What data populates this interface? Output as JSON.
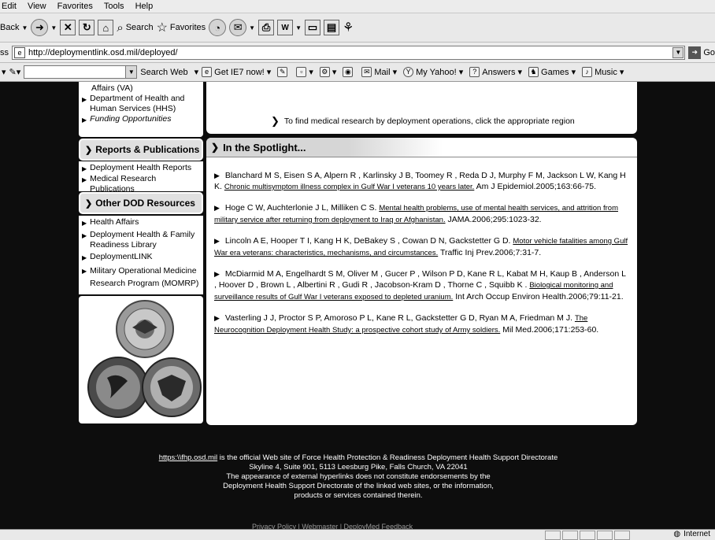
{
  "menubar": {
    "items": [
      "Edit",
      "View",
      "Favorites",
      "Tools",
      "Help"
    ]
  },
  "toolbar": {
    "back_label": "Back",
    "search_label": "Search",
    "favorites_label": "Favorites"
  },
  "address": {
    "label": "ss",
    "url": "http://deploymentlink.osd.mil/deployed/",
    "go_label": "Go"
  },
  "yahoo": {
    "search_web_label": "Search Web",
    "ie7_label": "Get IE7 now!",
    "mail_label": "Mail",
    "my_yahoo_label": "My Yahoo!",
    "answers_label": "Answers",
    "games_label": "Games",
    "music_label": "Music"
  },
  "sidebar": {
    "top_items": [
      {
        "label": "Affairs (VA)",
        "bullet": false
      },
      {
        "label": "Department of Health and Human Services (HHS)",
        "bullet": true
      },
      {
        "label": "Funding Opportunities",
        "bullet": true
      }
    ],
    "reports_heading": "Reports & Publications",
    "reports_items": [
      "Deployment Health Reports",
      "Medical Research Publications"
    ],
    "dod_heading": "Other DOD Resources",
    "dod_items": [
      "Health Affairs",
      "Deployment Health & Family Readiness Library",
      "DeploymentLINK",
      "Military Operational Medicine Research Program (MOMRP)"
    ]
  },
  "main": {
    "region_message": "To find medical research by deployment operations, click the appropriate region",
    "spotlight_heading": "In the Spotlight...",
    "citations": [
      {
        "authors": "Blanchard M S, Eisen S A, Alpern R , Karlinsky J B, Toomey R , Reda D J, Murphy F M, Jackson L W, Kang H K.",
        "title": "Chronic multisymptom illness complex in Gulf War I veterans 10 years later.",
        "source": "Am J Epidemiol.2005;163:66-75."
      },
      {
        "authors": "Hoge C W, Auchterlonie J L, Milliken C S.",
        "title": "Mental health problems, use of mental health services, and attrition from military service after returning from deployment to Iraq or Afghanistan.",
        "source": "JAMA.2006;295:1023-32."
      },
      {
        "authors": "Lincoln A E, Hooper T I, Kang H K, DeBakey S , Cowan D N, Gackstetter G D.",
        "title": "Motor vehicle fatalities among Gulf War era veterans: characteristics, mechanisms, and circumstances.",
        "source": "Traffic Inj Prev.2006;7:31-7."
      },
      {
        "authors": "McDiarmid M A, Engelhardt S M, Oliver M , Gucer P , Wilson P D, Kane R L, Kabat M H, Kaup B , Anderson L , Hoover D , Brown L , Albertini R , Gudi R , Jacobson-Kram D , Thorne C , Squibb K .",
        "title": "Biological monitoring and surveillance results of Gulf War I veterans exposed to depleted uranium.",
        "source": "Int Arch Occup Environ Health.2006;79:11-21."
      },
      {
        "authors": "Vasterling J J, Proctor S P, Amoroso P L, Kane R L, Gackstetter G D, Ryan M A, Friedman M J.",
        "title": "The Neurocognition Deployment Health Study: a prospective cohort study of Army soldiers.",
        "source": "Mil Med.2006;171:253-60."
      }
    ]
  },
  "footer": {
    "link": "https:\\\\fhp.osd.mil",
    "line1_rest": " is the official Web site of Force Health Protection & Readiness Deployment Health Support Directorate",
    "line2": "Skyline 4, Suite 901, 5113 Leesburg Pike, Falls Church, VA 22041",
    "line3": "The appearance of external hyperlinks does not constitute endorsements by the",
    "line4": "Deployment Health Support Directorate of the linked web sites, or the information,",
    "line5": "products or services contained therein.",
    "bottom_links": "Privacy Policy  |  Webmaster  |  DeployMed Feedback"
  },
  "status": {
    "zone_label": "Internet"
  },
  "icons": {
    "back": "back-arrow-icon",
    "forward": "forward-arrow-icon",
    "stop": "stop-icon",
    "refresh": "refresh-icon",
    "home": "home-icon",
    "search": "search-icon",
    "favorites": "star-icon",
    "history": "history-icon",
    "mail": "mail-icon",
    "print": "print-icon"
  }
}
